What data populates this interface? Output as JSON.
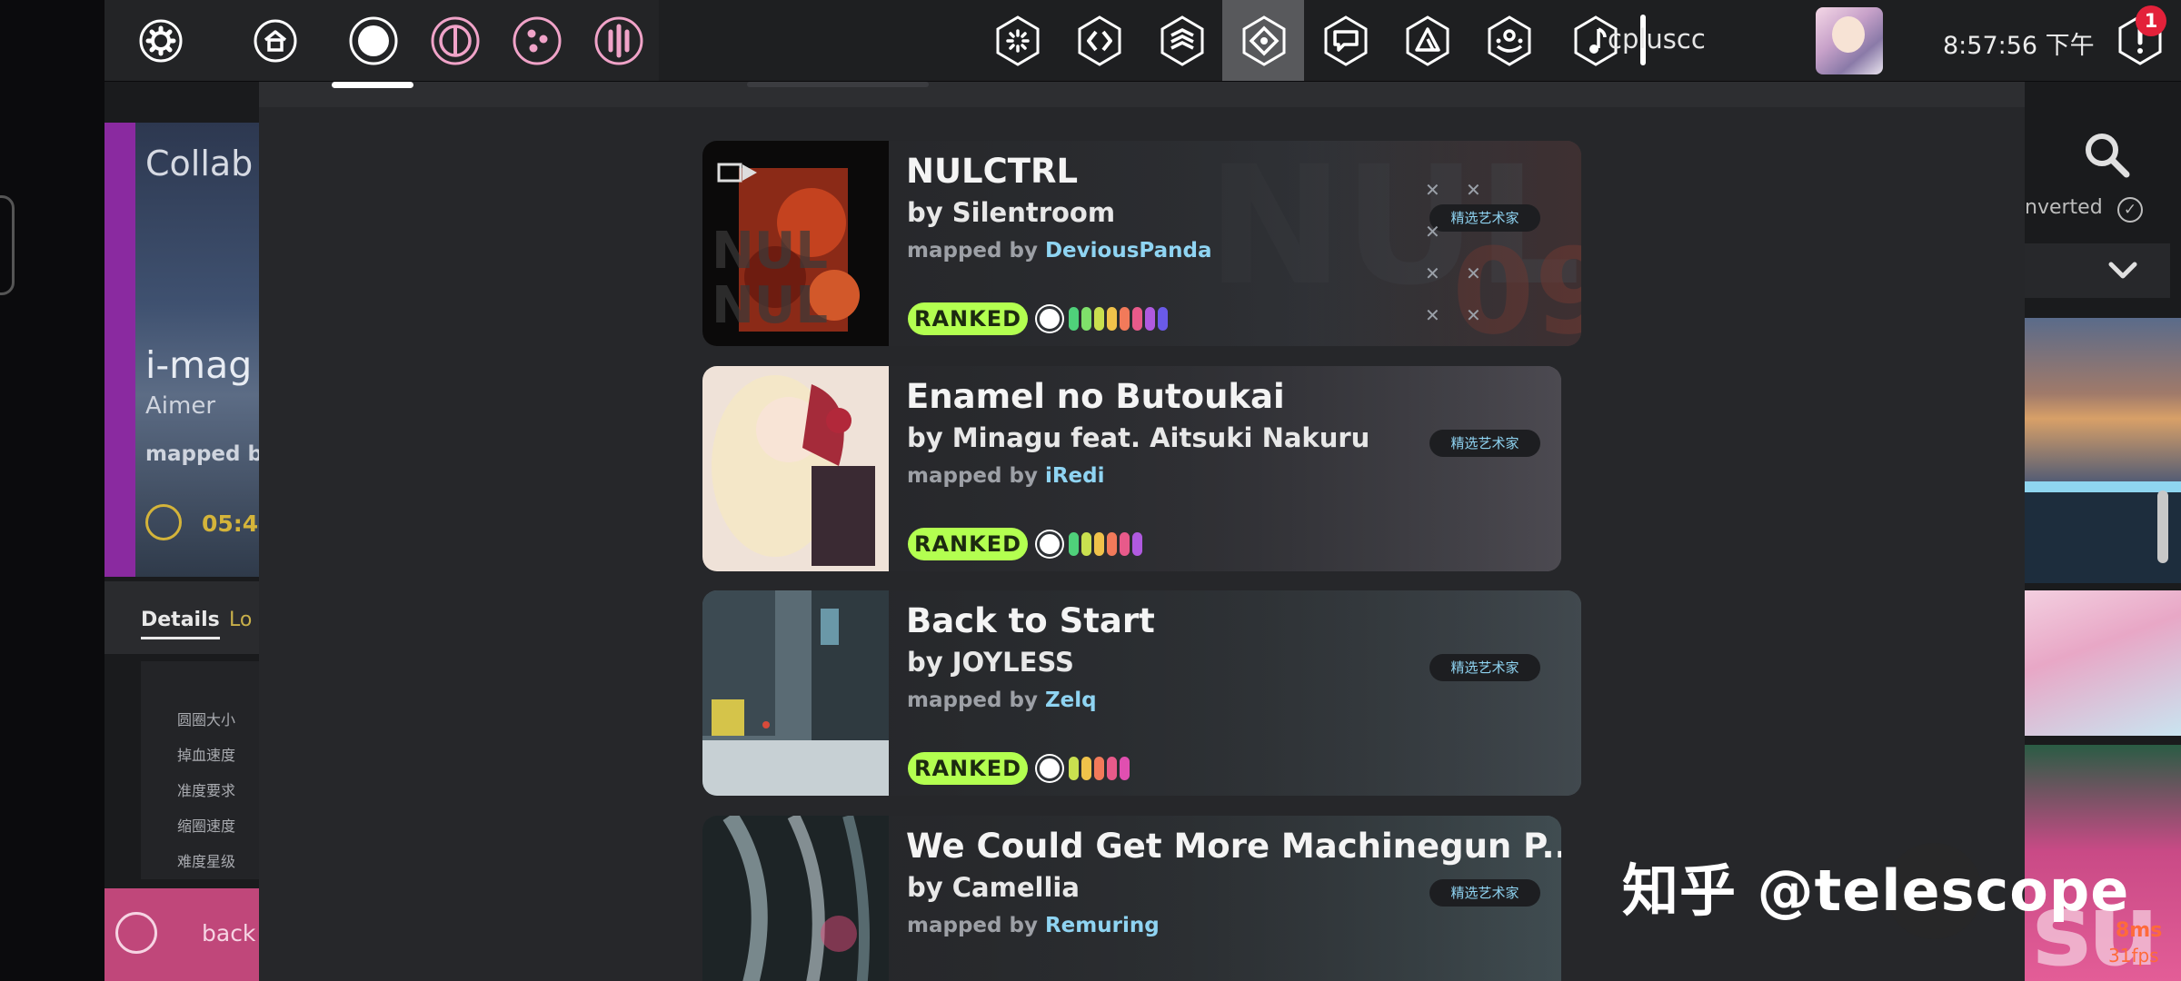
{
  "toolbar": {
    "left_buttons": [
      "settings-icon",
      "home-icon",
      "osu-mode-icon",
      "taiko-mode-icon",
      "catch-mode-icon",
      "mania-mode-icon"
    ],
    "right_buttons": [
      "beatmap-listing-icon",
      "rankings-icon",
      "changelog-icon",
      "beatmap-icon",
      "chat-icon",
      "tournaments-icon",
      "social-icon",
      "music-icon"
    ],
    "username": "cpluscc",
    "clock": "8:57:56 下午",
    "notification_count": "1",
    "colors": {
      "toolbar_bg": "#1e1f21",
      "active": "#58595c",
      "badge": "#e3213a"
    }
  },
  "background_left": {
    "title_partial": "Collab",
    "song_partial": "i-mag",
    "artist": "Aimer",
    "mapped_partial": "mapped by",
    "time_partial": "05:4",
    "tabs": [
      "Details",
      "Lo"
    ],
    "stats": [
      "圆圈大小",
      "掉血速度",
      "准度要求",
      "缩圈速度",
      "难度星级"
    ],
    "back_label": "back"
  },
  "background_right": {
    "converted_label": "nverted",
    "banner_text": "su",
    "ping": "8ms",
    "fps": "31fps"
  },
  "watermark": "知乎 @telescope",
  "beatmaps": [
    {
      "title": "NULCTRL",
      "artist": "by Silentroom",
      "mapped_by_label": "mapped by ",
      "mapper": "DeviousPanda",
      "tag": "精选艺术家",
      "status": "RANKED",
      "difficulties": [
        "#4fd17a",
        "#7fe06a",
        "#c9e04f",
        "#f0c24a",
        "#f27a5a",
        "#e85a8a",
        "#b05ae0",
        "#6a5ae8"
      ]
    },
    {
      "title": "Enamel no Butoukai",
      "artist": "by Minagu feat. Aitsuki Nakuru",
      "mapped_by_label": "mapped by ",
      "mapper": "iRedi",
      "tag": "精选艺术家",
      "status": "RANKED",
      "difficulties": [
        "#4fd17a",
        "#c9e04f",
        "#f0c24a",
        "#f27a5a",
        "#e85a8a",
        "#b05ae0"
      ]
    },
    {
      "title": "Back to Start",
      "artist": "by JOYLESS",
      "mapped_by_label": "mapped by ",
      "mapper": "Zelq",
      "tag": "精选艺术家",
      "status": "RANKED",
      "difficulties": [
        "#c9e04f",
        "#f0c24a",
        "#f27a5a",
        "#e85a8a",
        "#e04fb0"
      ]
    },
    {
      "title": "We Could Get More Machinegun P...",
      "artist": "by Camellia",
      "mapped_by_label": "mapped by ",
      "mapper": "Remuring",
      "tag": "精选艺术家",
      "status": "RANKED",
      "difficulties": []
    }
  ]
}
